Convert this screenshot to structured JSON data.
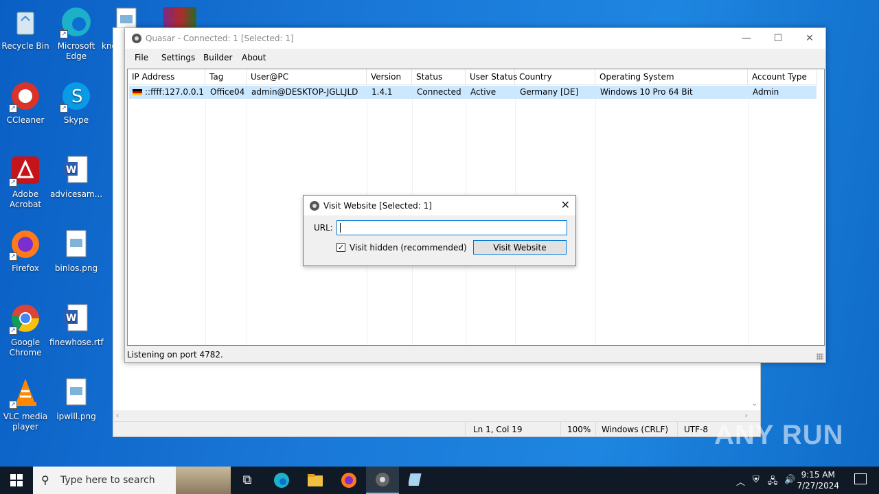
{
  "desktop": {
    "icons": [
      {
        "label": "Recycle Bin"
      },
      {
        "label": "Microsoft Edge"
      },
      {
        "label": "know"
      },
      {
        "label": "CCleaner"
      },
      {
        "label": "Skype"
      },
      {
        "label": "Adobe Acrobat"
      },
      {
        "label": "advicesam..."
      },
      {
        "label": "Firefox"
      },
      {
        "label": "binlos.png"
      },
      {
        "label": "Google Chrome"
      },
      {
        "label": "finewhose.rtf"
      },
      {
        "label": "VLC media player"
      },
      {
        "label": "ipwill.png"
      }
    ]
  },
  "notepad": {
    "status": {
      "position": "Ln 1, Col 19",
      "zoom": "100%",
      "line_ending": "Windows (CRLF)",
      "encoding": "UTF-8"
    }
  },
  "quasar": {
    "title": "Quasar - Connected: 1 [Selected: 1]",
    "menu": [
      "File",
      "Settings",
      "Builder",
      "About"
    ],
    "columns": [
      "IP Address",
      "Tag",
      "User@PC",
      "Version",
      "Status",
      "User Status",
      "Country",
      "Operating System",
      "Account Type"
    ],
    "rows": [
      {
        "ip": "::ffff:127.0.0.1",
        "tag": "Office04",
        "user": "admin@DESKTOP-JGLLJLD",
        "version": "1.4.1",
        "status": "Connected",
        "user_status": "Active",
        "country": "Germany [DE]",
        "os": "Windows 10 Pro 64 Bit",
        "account": "Admin"
      }
    ],
    "status_text": "Listening on port 4782."
  },
  "dialog": {
    "title": "Visit Website [Selected: 1]",
    "url_label": "URL:",
    "url_value": "",
    "checkbox_label": "Visit hidden (recommended)",
    "checkbox_checked": true,
    "button_label": "Visit Website"
  },
  "taskbar": {
    "search_placeholder": "Type here to search",
    "time": "9:15 AM",
    "date": "7/27/2024"
  },
  "watermark": "ANY RUN"
}
